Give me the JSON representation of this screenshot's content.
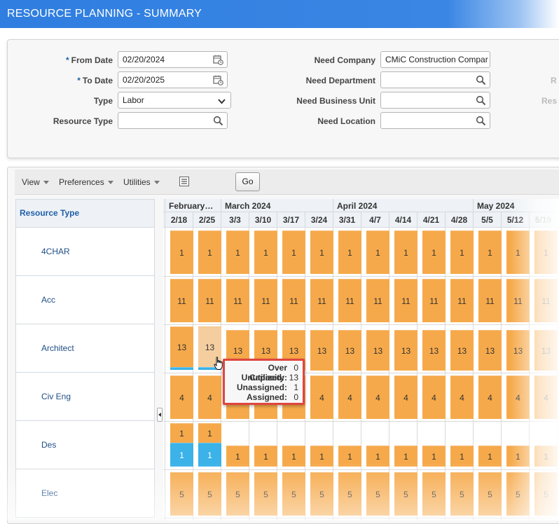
{
  "title": "RESOURCE PLANNING - SUMMARY",
  "filters": {
    "from_date": {
      "label": "From Date",
      "value": "02/20/2024",
      "required": "*"
    },
    "to_date": {
      "label": "To Date",
      "value": "02/20/2025",
      "required": "*"
    },
    "type": {
      "label": "Type",
      "value": "Labor"
    },
    "resource_type": {
      "label": "Resource Type",
      "value": ""
    },
    "need_company": {
      "label": "Need Company",
      "value": "CMiC Construction Compar"
    },
    "need_department": {
      "label": "Need Department",
      "value": ""
    },
    "need_business_unit": {
      "label": "Need Business Unit",
      "value": ""
    },
    "need_location": {
      "label": "Need Location",
      "value": ""
    },
    "cut_label_1": "R",
    "cut_label_2": "Res"
  },
  "toolbar": {
    "view": "View",
    "preferences": "Preferences",
    "utilities": "Utilities",
    "go": "Go"
  },
  "grid": {
    "resource_type_header": "Resource Type",
    "months": [
      "February…",
      "March 2024",
      "April 2024",
      "May 2024"
    ],
    "weeks": [
      "2/18",
      "2/25",
      "3/3",
      "3/10",
      "3/17",
      "3/24",
      "3/31",
      "4/7",
      "4/14",
      "4/21",
      "4/28",
      "5/5",
      "5/12",
      "5/19"
    ],
    "rows": [
      {
        "name": "4CHAR",
        "value": "1"
      },
      {
        "name": "Acc",
        "value": "11"
      },
      {
        "name": "Architect",
        "value": "13"
      },
      {
        "name": "Civ Eng",
        "value": "4"
      },
      {
        "name": "Des",
        "value": "1"
      },
      {
        "name": "Elec",
        "value": "5"
      }
    ]
  },
  "tooltip": {
    "over_capacity_label": "Over Capacity:",
    "over_capacity": "0",
    "unutilized_label": "Unutilized:",
    "unutilized": "13",
    "unassigned_label": "Unassigned:",
    "unassigned": "1",
    "assigned_label": "Assigned:",
    "assigned": "0"
  },
  "colors": {
    "header_blue": "#2f7ee0",
    "bar_orange": "#f6a94a",
    "bar_blue": "#3bb2e8",
    "tooltip_border": "#e0463f"
  }
}
